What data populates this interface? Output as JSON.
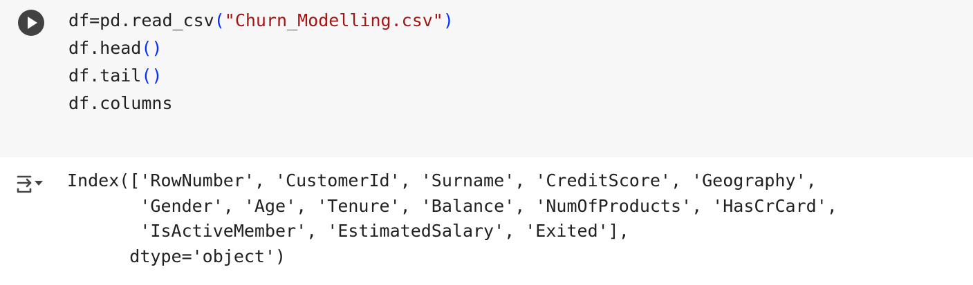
{
  "code_cell": {
    "run_icon": "play-circle-icon",
    "lines": [
      {
        "prefix": "df=pd.read_csv",
        "open": "(",
        "arg": "\"Churn_Modelling.csv\"",
        "close": ")"
      },
      {
        "prefix": "df.head",
        "open": "(",
        "arg": "",
        "close": ")"
      },
      {
        "prefix": "df.tail",
        "open": "(",
        "arg": "",
        "close": ")"
      },
      {
        "prefix": "df.columns",
        "open": "",
        "arg": "",
        "close": ""
      }
    ]
  },
  "output_cell": {
    "toggle_icon": "output-collapse-icon",
    "lines": [
      "Index(['RowNumber', 'CustomerId', 'Surname', 'CreditScore', 'Geography',",
      "       'Gender', 'Age', 'Tenure', 'Balance', 'NumOfProducts', 'HasCrCard',",
      "       'IsActiveMember', 'EstimatedSalary', 'Exited'],",
      "      dtype='object')"
    ]
  }
}
